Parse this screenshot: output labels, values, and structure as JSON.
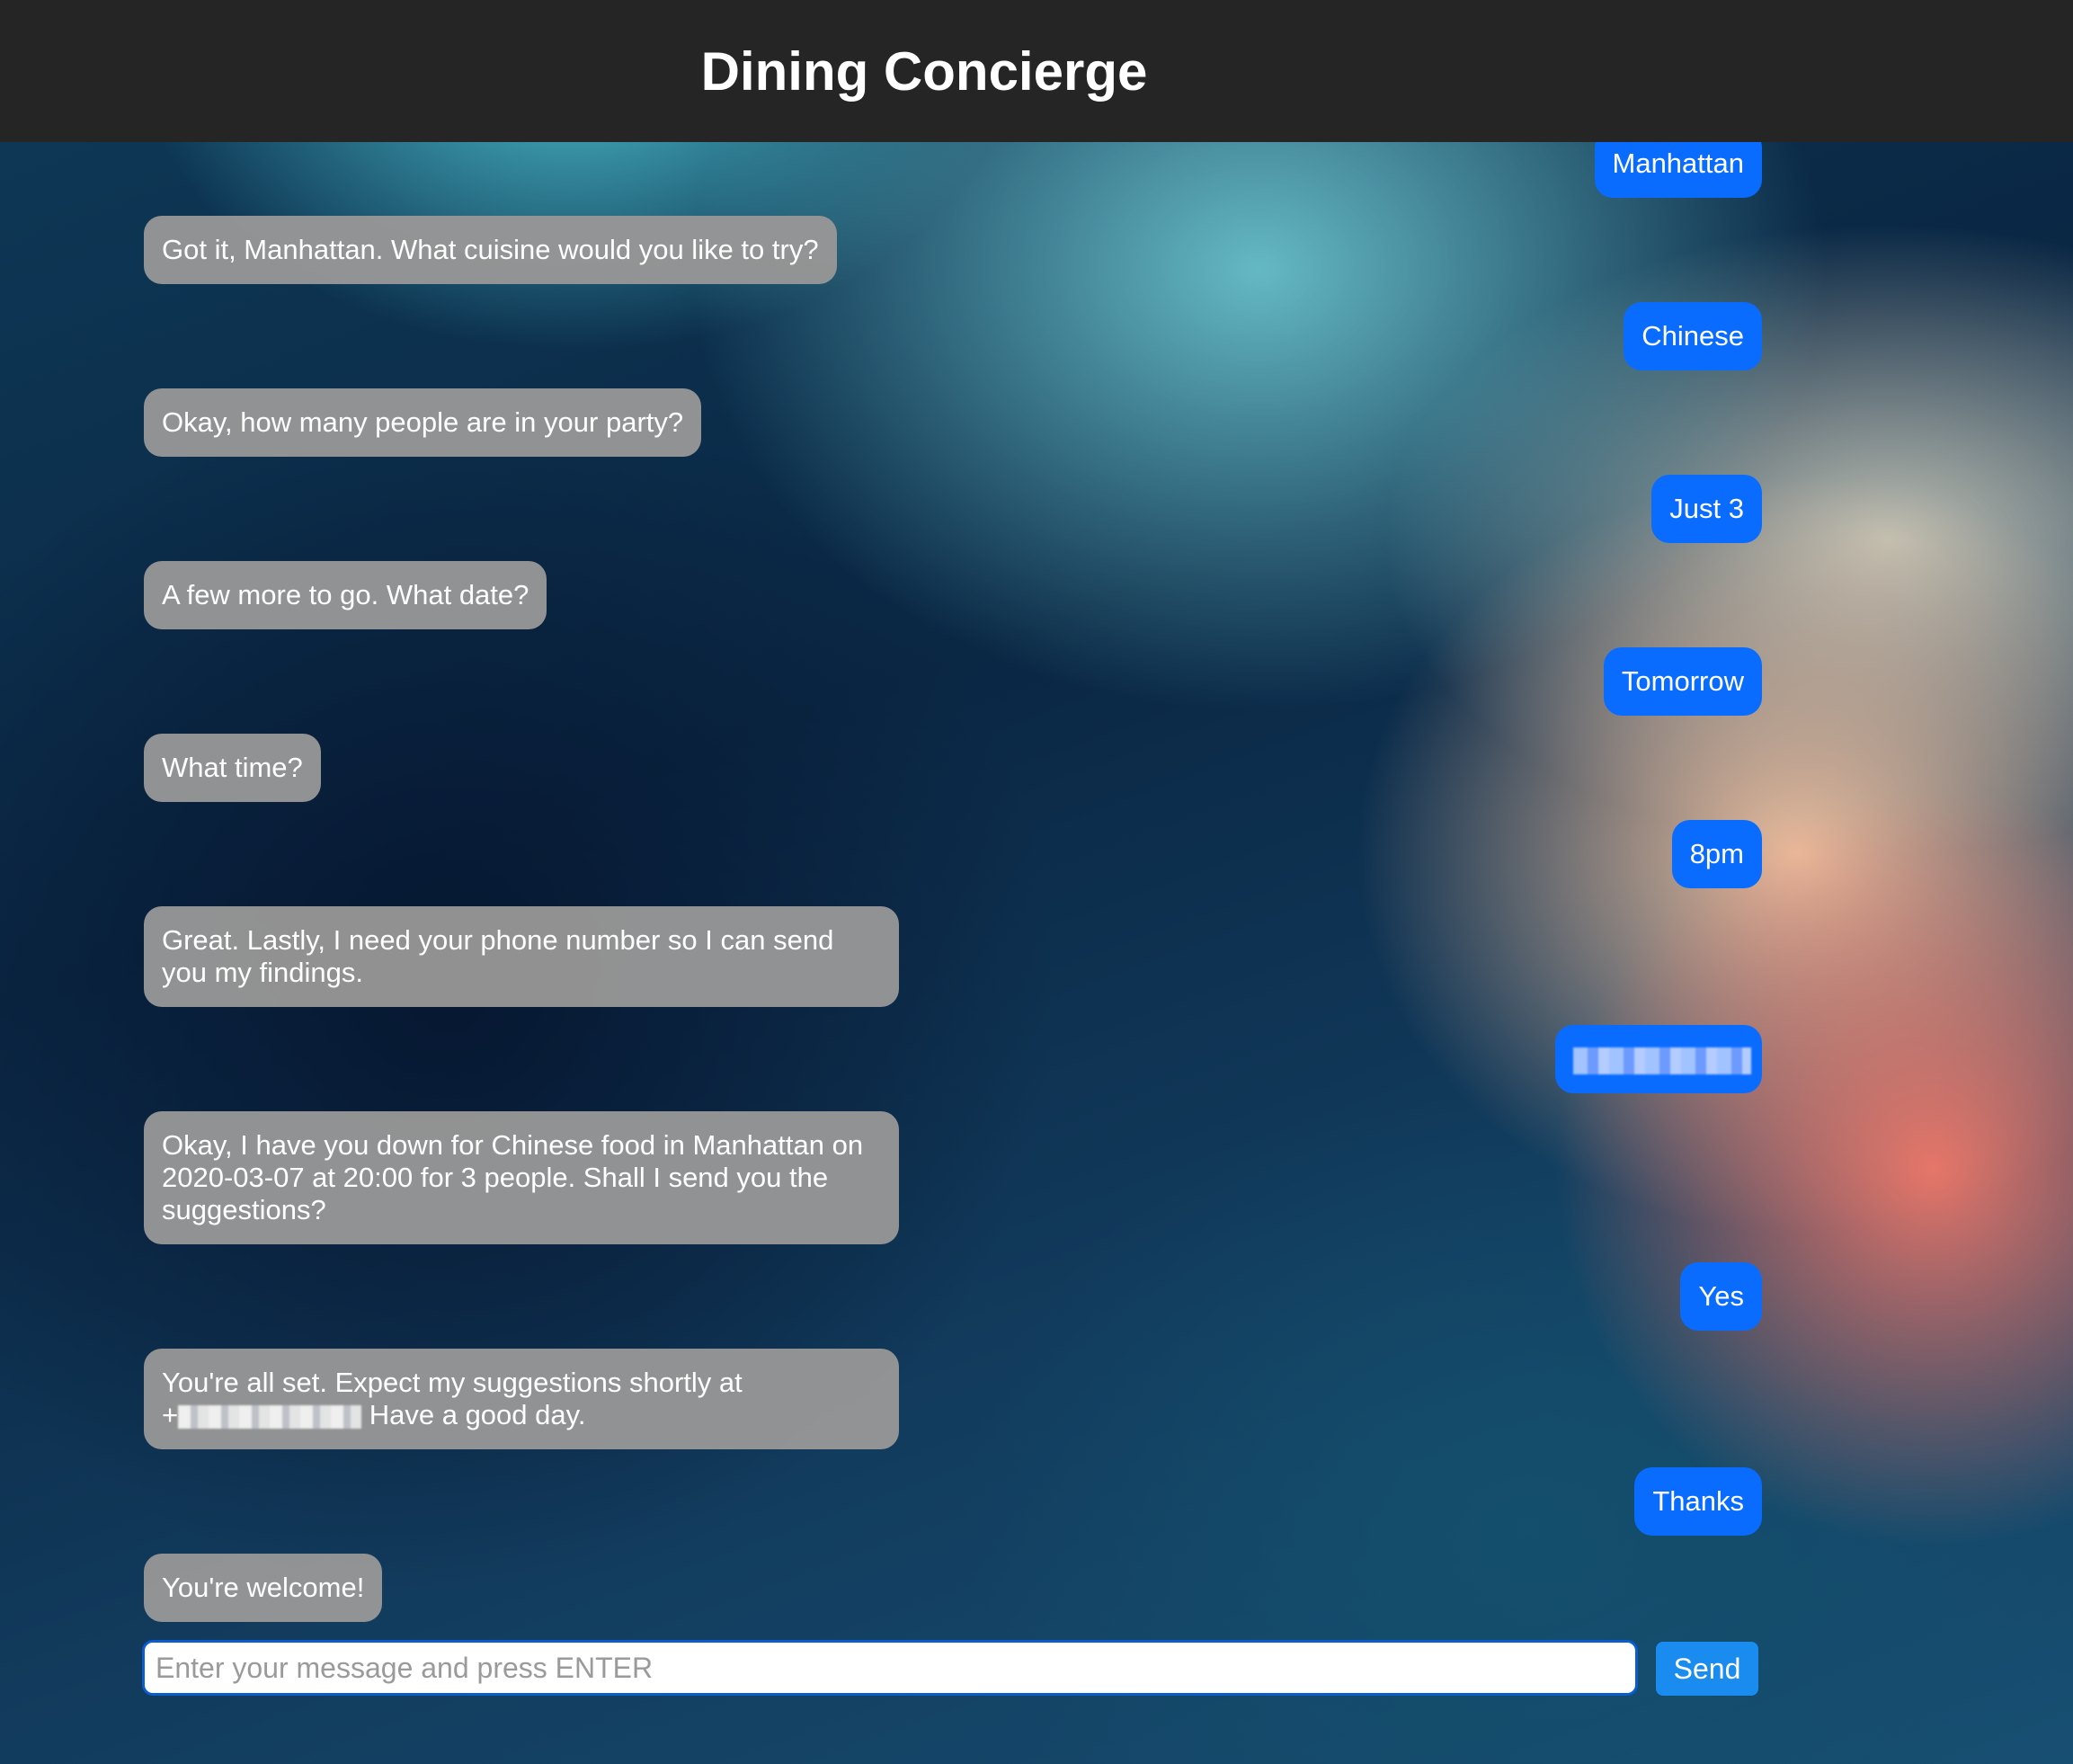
{
  "app": {
    "title": "Dining Concierge"
  },
  "conversation": [
    {
      "sender": "user",
      "text": "Manhattan"
    },
    {
      "sender": "bot",
      "text": "Got it, Manhattan. What cuisine would you like to try?"
    },
    {
      "sender": "user",
      "text": "Chinese"
    },
    {
      "sender": "bot",
      "text": "Okay, how many people are in your party?"
    },
    {
      "sender": "user",
      "text": "Just 3"
    },
    {
      "sender": "bot",
      "text": "A few more to go. What date?"
    },
    {
      "sender": "user",
      "text": "Tomorrow"
    },
    {
      "sender": "bot",
      "text": "What time?"
    },
    {
      "sender": "user",
      "text": "8pm"
    },
    {
      "sender": "bot",
      "text": "Great. Lastly, I need your phone number so I can send you my findings."
    },
    {
      "sender": "user",
      "text": ""
    },
    {
      "sender": "bot",
      "text": "Okay, I have you down for Chinese food in Manhattan on 2020-03-07 at 20:00 for 3 people. Shall I send you the suggestions?"
    },
    {
      "sender": "user",
      "text": "Yes"
    },
    {
      "sender": "bot",
      "text_before": "You're all set. Expect my suggestions shortly at",
      "text_prefix": "+",
      "text_after": "Have a good day."
    },
    {
      "sender": "user",
      "text": "Thanks"
    },
    {
      "sender": "bot",
      "text": "You're welcome!"
    }
  ],
  "composer": {
    "placeholder": "Enter your message and press ENTER",
    "value": ""
  },
  "send_button": {
    "label": "Send"
  },
  "colors": {
    "header_bg": "#252525",
    "bot_bubble": "#969696",
    "user_bubble": "#0a6cff",
    "send_button": "#1a8cf0"
  }
}
